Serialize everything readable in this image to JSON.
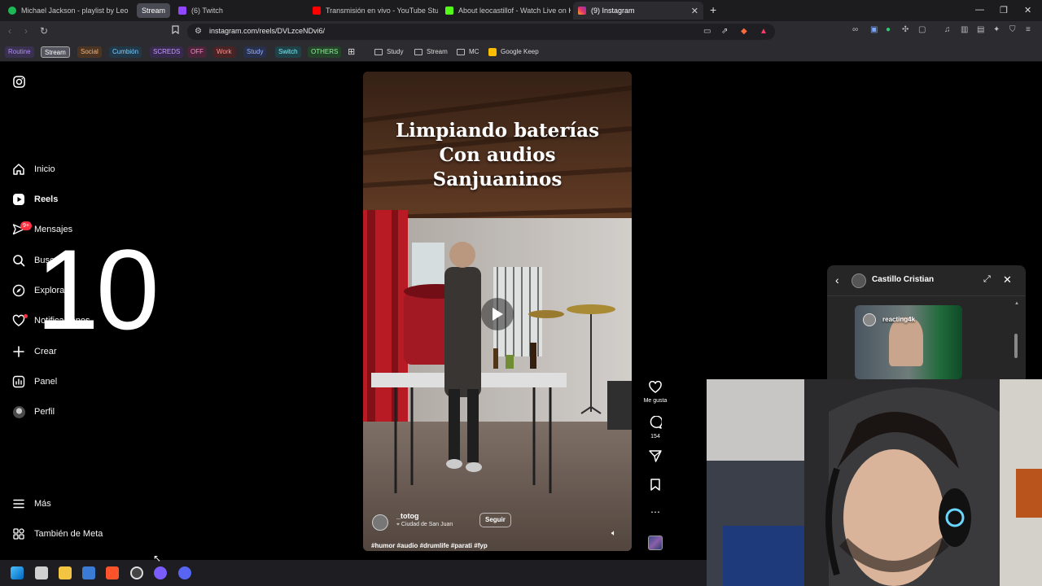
{
  "browser": {
    "tabs": [
      {
        "title": "Michael Jackson - playlist by Leo | Sp",
        "favicon_color": "#1db954"
      },
      {
        "group": "Stream"
      },
      {
        "title": "(6) Twitch",
        "favicon_color": "#9146ff"
      },
      {
        "title": "Transmisión en vivo - YouTube Studio",
        "favicon_color": "#ff0000"
      },
      {
        "title": "About leocastillof - Watch Live on Ki",
        "favicon_color": "#53fc18"
      },
      {
        "title": "(9) Instagram",
        "favicon_color": "#e1306c",
        "active": true
      }
    ],
    "new_tab": "+",
    "url": "instagram.com/reels/DVLzceNDvi6/",
    "bookmark_chips": [
      {
        "label": "Routine",
        "color": "#b58cff",
        "bg": "#3a3150"
      },
      {
        "label": "Stream",
        "color": "#ffffff",
        "bg": "#55555f"
      },
      {
        "label": "Social",
        "color": "#ffb36b",
        "bg": "#4a3524"
      },
      {
        "label": "Cumbión",
        "color": "#7fd0ff",
        "bg": "#203848"
      },
      {
        "label": "SCREDS",
        "color": "#c49aff",
        "bg": "#382a4d"
      },
      {
        "label": "OFF",
        "color": "#ff86c8",
        "bg": "#4a2438"
      },
      {
        "label": "Work",
        "color": "#ff8f8f",
        "bg": "#4a2424"
      },
      {
        "label": "Study",
        "color": "#9bb2ff",
        "bg": "#27304d"
      },
      {
        "label": "Switch",
        "color": "#7ff0ff",
        "bg": "#1f4248"
      },
      {
        "label": "OTHERS",
        "color": "#8ff59a",
        "bg": "#234428"
      }
    ],
    "bookmark_folders": [
      "Study",
      "Stream",
      "MC",
      "Google Keep"
    ]
  },
  "sidebar": {
    "items": [
      {
        "label": "Inicio",
        "icon": "home-icon"
      },
      {
        "label": "Reels",
        "icon": "reels-icon",
        "bold": true
      },
      {
        "label": "Mensajes",
        "icon": "messages-icon",
        "badge": "9+"
      },
      {
        "label": "Buscar",
        "icon": "search-icon"
      },
      {
        "label": "Explorar",
        "icon": "explore-icon"
      },
      {
        "label": "Notificaciones",
        "icon": "heart-icon",
        "dot": true
      },
      {
        "label": "Crear",
        "icon": "plus-icon"
      },
      {
        "label": "Panel",
        "icon": "panel-icon"
      },
      {
        "label": "Perfil",
        "icon": "avatar"
      }
    ],
    "bottom": [
      {
        "label": "Más",
        "icon": "menu-icon"
      },
      {
        "label": "También de Meta",
        "icon": "meta-icon"
      }
    ]
  },
  "overlay_number": "10",
  "reel": {
    "title_lines": [
      "Limpiando baterías",
      "Con audios",
      "Sanjuaninos"
    ],
    "username": "_totog",
    "location": "Ciudad de San Juan",
    "follow_label": "Seguir",
    "hashtags": "#humor #audio #drumlife #parati #fyp",
    "actions": {
      "like_label": "Me gusta",
      "comments_count": "154"
    }
  },
  "chat": {
    "name": "Castillo Cristian",
    "card_label": "reacting4k"
  },
  "colors": {
    "accent": "#ff3040",
    "chrome_bg": "#2b2b30",
    "tabbar_bg": "#1c1c1f"
  }
}
